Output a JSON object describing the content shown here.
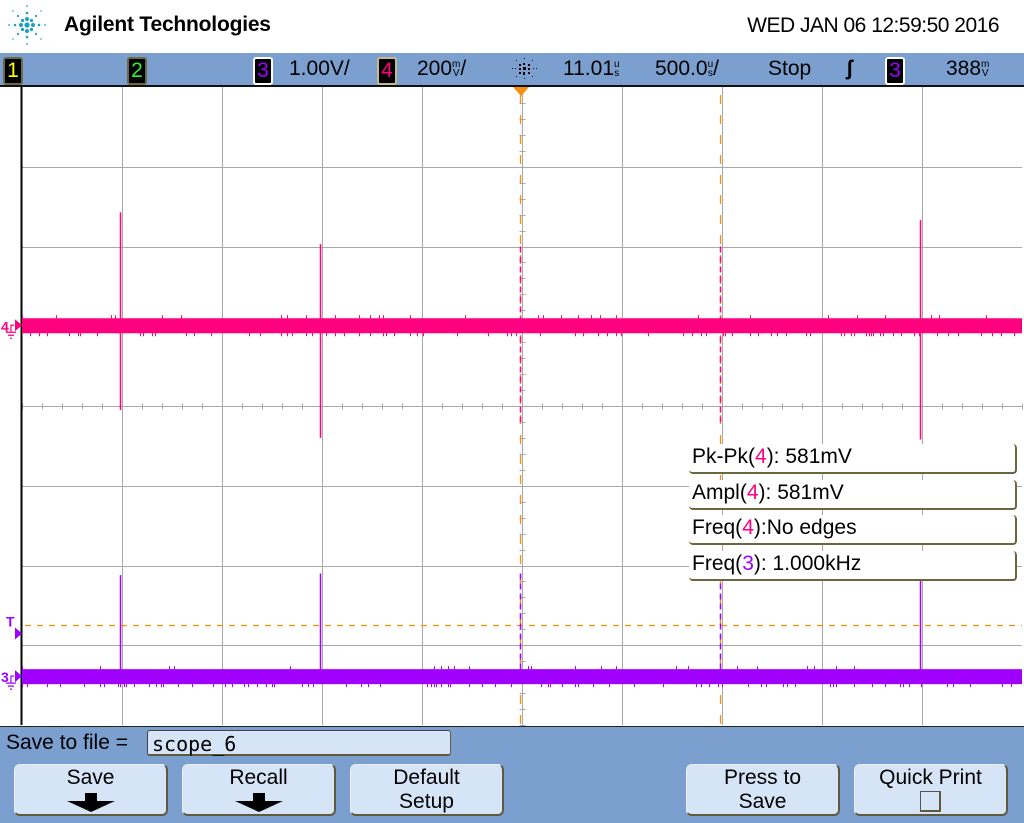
{
  "header": {
    "brand": "Agilent Technologies",
    "datetime": "WED JAN 06 12:59:50 2016",
    "logo_icon": "agilent-spark-logo"
  },
  "status_bar": {
    "channels": [
      {
        "number": "1",
        "color": "#ffff00"
      },
      {
        "number": "2",
        "color": "#33ee33"
      },
      {
        "number": "3",
        "color": "#a000ff",
        "scale": "1.00V/"
      },
      {
        "number": "4",
        "color": "#ff007f",
        "scale_value": "200",
        "scale_unit_top": "m",
        "scale_unit_bottom": "V",
        "scale_suffix": "/"
      }
    ],
    "acquisition_icon": "acquisition-spark-icon",
    "delay_value": "11.01",
    "delay_unit_top": "u",
    "delay_unit_bottom": "s",
    "timebase_value": "500.0",
    "timebase_unit_top": "u",
    "timebase_unit_bottom": "s",
    "timebase_suffix": "/",
    "run_state": "Stop",
    "trigger_slope_icon": "rising-edge-icon",
    "trigger_slope_glyph": "ʃ",
    "trigger_source": "3",
    "trigger_level_value": "388",
    "trigger_level_unit_top": "m",
    "trigger_level_unit_bottom": "V"
  },
  "display": {
    "horizontal_divisions": 10,
    "vertical_divisions": 8,
    "colors": {
      "grid": "#a8a8a8",
      "ch3": "#a000ff",
      "ch4": "#ff007f",
      "trigger": "#f5900f",
      "axis": "#000000"
    },
    "markers": {
      "ch4_label": "4",
      "ch3_label": "3",
      "trigger_label": "T"
    },
    "traces": {
      "ch4": {
        "baseline_div": 5.0,
        "spike_times_div": [
          1.0,
          3.0,
          5.0,
          7.0,
          9.0
        ],
        "spike_top_div": [
          6.43,
          6.03,
          6.0,
          6.0,
          6.33
        ],
        "spike_bottom_div": [
          3.95,
          3.6,
          3.8,
          3.8,
          3.58
        ]
      },
      "ch3": {
        "baseline_div": 0.6,
        "spike_times_div": [
          1.0,
          3.0,
          5.0,
          7.0,
          9.0
        ],
        "spike_top_div": [
          1.88,
          1.9,
          1.9,
          1.9,
          1.9
        ]
      },
      "trigger_level_div": 1.25,
      "cursor_times_div": [
        5.0,
        7.0
      ]
    }
  },
  "measurements": [
    {
      "name": "Pk-Pk(",
      "channel": "4",
      "suffix": "): 581mV",
      "channel_color": "#ff007f"
    },
    {
      "name": "Ampl(",
      "channel": "4",
      "suffix": "): 581mV",
      "channel_color": "#ff007f"
    },
    {
      "name": "Freq(",
      "channel": "4",
      "suffix": "):No edges",
      "channel_color": "#ff007f"
    },
    {
      "name": "Freq(",
      "channel": "3",
      "suffix": "): 1.000kHz",
      "channel_color": "#a000ff"
    }
  ],
  "softkeys": {
    "file_label": "Save to file =",
    "file_value": "scope_6",
    "buttons": [
      {
        "label_line1": "Save",
        "label_line2": "",
        "icon": "arrow-down-icon"
      },
      {
        "label_line1": "Recall",
        "label_line2": "",
        "icon": "arrow-down-icon"
      },
      {
        "label_line1": "Default",
        "label_line2": "Setup"
      },
      {
        "label_line1": "Press to",
        "label_line2": "Save"
      },
      {
        "label_line1": "Quick Print",
        "label_line2": "",
        "icon": "checkbox-icon"
      }
    ]
  }
}
